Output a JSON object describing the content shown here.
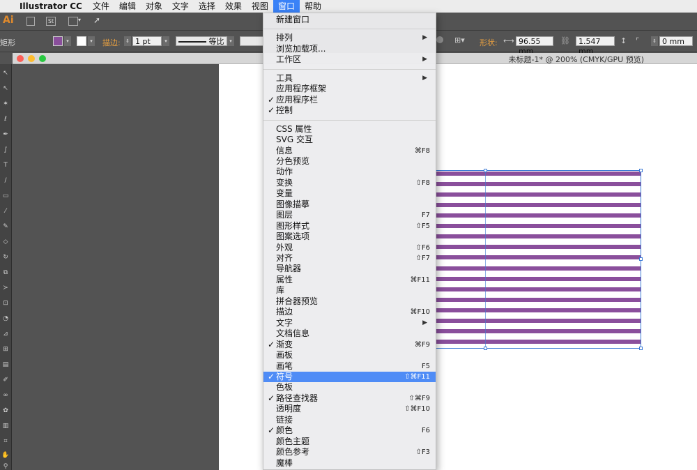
{
  "menubar": {
    "app_name": "Illustrator CC",
    "items": [
      "文件",
      "编辑",
      "对象",
      "文字",
      "选择",
      "效果",
      "视图",
      "窗口",
      "帮助"
    ],
    "active": "窗口"
  },
  "appbar": {
    "logo": "Ai",
    "st_label": "St"
  },
  "control": {
    "tool_name": "矩形",
    "fill_color": "#8a4f9c",
    "stroke_label": "描边:",
    "stroke_weight": "1 pt",
    "stroke_profile": "等比",
    "shape_label": "形状:",
    "width_value": "96.55 mm",
    "height_value": "1.547 mm",
    "corner_value": "0 mm"
  },
  "document": {
    "title": "未标题-1* @ 200% (CMYK/GPU 预览)",
    "stripe_color": "#8a4f9c",
    "stripe_count": 17
  },
  "window_menu": {
    "groups": [
      [
        {
          "label": "新建窗口",
          "checked": false,
          "shortcut": "",
          "submenu": false
        }
      ],
      [
        {
          "label": "排列",
          "checked": false,
          "shortcut": "",
          "submenu": true
        },
        {
          "label": "浏览加载项...",
          "checked": false,
          "shortcut": "",
          "submenu": false
        },
        {
          "label": "工作区",
          "checked": false,
          "shortcut": "",
          "submenu": true
        }
      ],
      [
        {
          "label": "工具",
          "checked": false,
          "shortcut": "",
          "submenu": true
        },
        {
          "label": "应用程序框架",
          "checked": false,
          "shortcut": "",
          "submenu": false
        },
        {
          "label": "应用程序栏",
          "checked": true,
          "shortcut": "",
          "submenu": false
        },
        {
          "label": "控制",
          "checked": true,
          "shortcut": "",
          "submenu": false
        }
      ],
      [
        {
          "label": "CSS 属性",
          "checked": false,
          "shortcut": "",
          "submenu": false
        },
        {
          "label": "SVG 交互",
          "checked": false,
          "shortcut": "",
          "submenu": false
        },
        {
          "label": "信息",
          "checked": false,
          "shortcut": "⌘F8",
          "submenu": false
        },
        {
          "label": "分色预览",
          "checked": false,
          "shortcut": "",
          "submenu": false
        },
        {
          "label": "动作",
          "checked": false,
          "shortcut": "",
          "submenu": false
        },
        {
          "label": "变换",
          "checked": false,
          "shortcut": "⇧F8",
          "submenu": false
        },
        {
          "label": "变量",
          "checked": false,
          "shortcut": "",
          "submenu": false
        },
        {
          "label": "图像描摹",
          "checked": false,
          "shortcut": "",
          "submenu": false
        },
        {
          "label": "图层",
          "checked": false,
          "shortcut": "F7",
          "submenu": false
        },
        {
          "label": "图形样式",
          "checked": false,
          "shortcut": "⇧F5",
          "submenu": false
        },
        {
          "label": "图案选项",
          "checked": false,
          "shortcut": "",
          "submenu": false
        },
        {
          "label": "外观",
          "checked": false,
          "shortcut": "⇧F6",
          "submenu": false
        },
        {
          "label": "对齐",
          "checked": false,
          "shortcut": "⇧F7",
          "submenu": false
        },
        {
          "label": "导航器",
          "checked": false,
          "shortcut": "",
          "submenu": false
        },
        {
          "label": "属性",
          "checked": false,
          "shortcut": "⌘F11",
          "submenu": false
        },
        {
          "label": "库",
          "checked": false,
          "shortcut": "",
          "submenu": false
        },
        {
          "label": "拼合器预览",
          "checked": false,
          "shortcut": "",
          "submenu": false
        },
        {
          "label": "描边",
          "checked": false,
          "shortcut": "⌘F10",
          "submenu": false
        },
        {
          "label": "文字",
          "checked": false,
          "shortcut": "",
          "submenu": true
        },
        {
          "label": "文档信息",
          "checked": false,
          "shortcut": "",
          "submenu": false
        },
        {
          "label": "渐变",
          "checked": true,
          "shortcut": "⌘F9",
          "submenu": false
        },
        {
          "label": "画板",
          "checked": false,
          "shortcut": "",
          "submenu": false
        },
        {
          "label": "画笔",
          "checked": false,
          "shortcut": "F5",
          "submenu": false
        },
        {
          "label": "符号",
          "checked": true,
          "shortcut": "⇧⌘F11",
          "submenu": false,
          "highlighted": true
        },
        {
          "label": "色板",
          "checked": false,
          "shortcut": "",
          "submenu": false
        },
        {
          "label": "路径查找器",
          "checked": true,
          "shortcut": "⇧⌘F9",
          "submenu": false
        },
        {
          "label": "透明度",
          "checked": false,
          "shortcut": "⇧⌘F10",
          "submenu": false
        },
        {
          "label": "链接",
          "checked": false,
          "shortcut": "",
          "submenu": false
        },
        {
          "label": "颜色",
          "checked": true,
          "shortcut": "F6",
          "submenu": false
        },
        {
          "label": "颜色主题",
          "checked": false,
          "shortcut": "",
          "submenu": false
        },
        {
          "label": "颜色参考",
          "checked": false,
          "shortcut": "⇧F3",
          "submenu": false
        },
        {
          "label": "魔棒",
          "checked": false,
          "shortcut": "",
          "submenu": false
        }
      ]
    ]
  }
}
